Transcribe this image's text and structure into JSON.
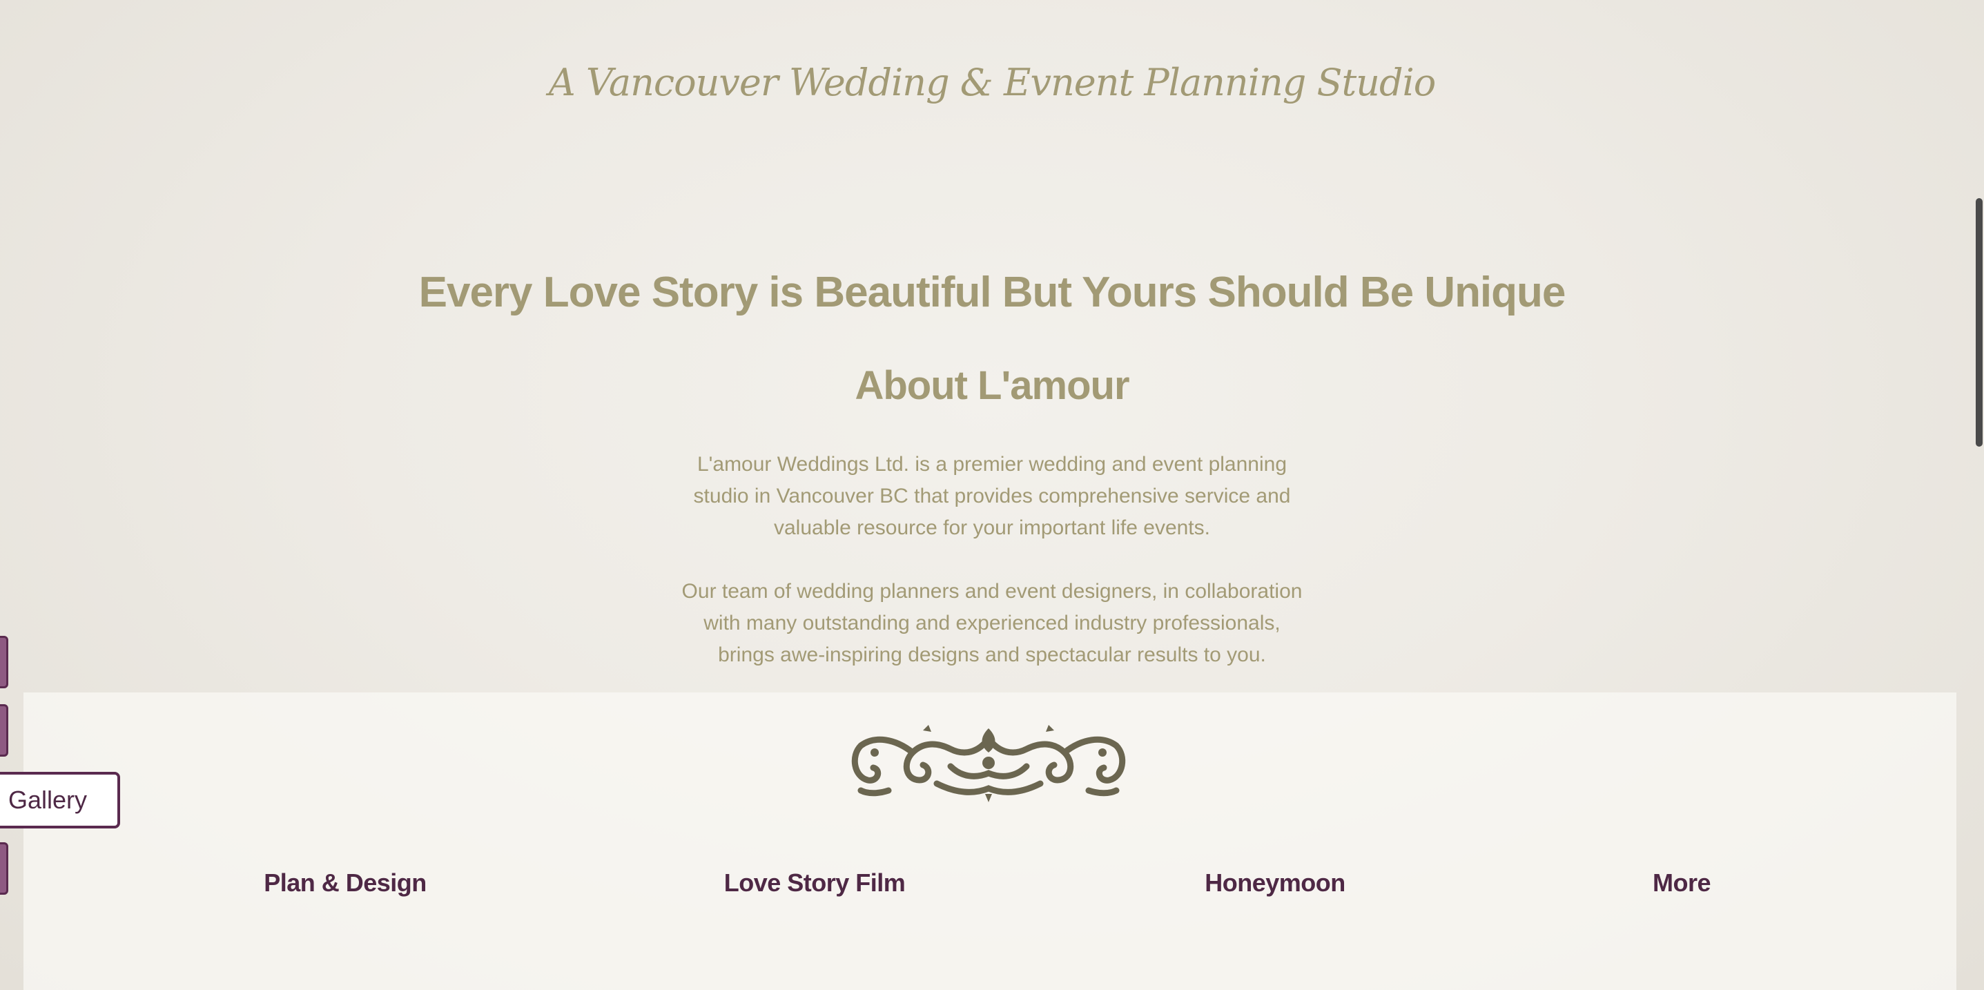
{
  "header": {
    "tagline": "A Vancouver Wedding & Evnent Planning Studio"
  },
  "hero": {
    "headline": "Every Love Story is Beautiful But Yours Should Be Unique"
  },
  "about": {
    "title": "About L'amour",
    "paragraph1_lines": [
      "L'amour Weddings Ltd. is a premier wedding and event planning",
      "studio in Vancouver BC that provides comprehensive service and",
      "valuable resource for your important life events."
    ],
    "paragraph2_lines": [
      "Our team of wedding planners and event designers, in collaboration",
      "with many outstanding and experienced industry professionals,",
      "brings awe-inspiring designs and spectacular results to you."
    ]
  },
  "ornament": {
    "icon": "flourish-ornament-icon",
    "color": "#6b6650"
  },
  "services": {
    "items": [
      {
        "label": "Plan & Design"
      },
      {
        "label": "Love Story Film"
      },
      {
        "label": "Honeymoon"
      },
      {
        "label": "More"
      }
    ]
  },
  "side_nav": {
    "gallery_label": "Gallery"
  },
  "colors": {
    "text_gold": "#a29a75",
    "text_plum": "#4e2845",
    "accent_plum": "#5a2a4f",
    "tab_fill": "#8e5a82"
  }
}
